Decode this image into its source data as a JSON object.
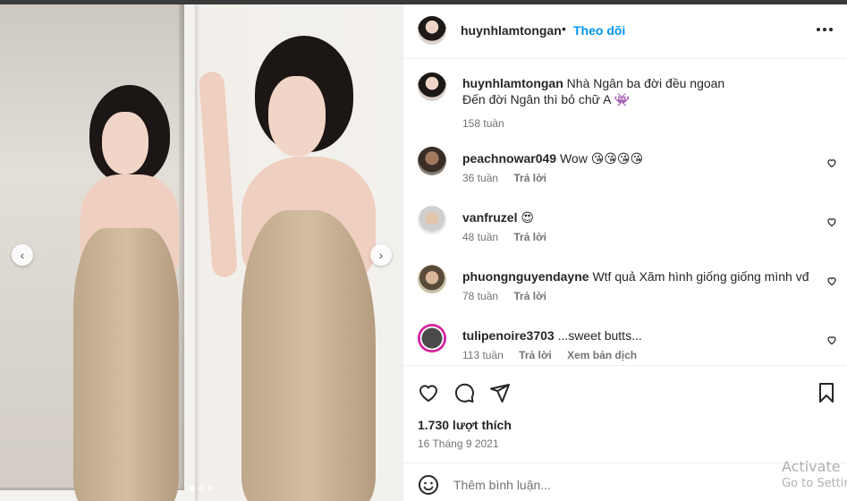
{
  "post": {
    "owner": "huynhlamtongan",
    "separator": "•",
    "follow_label": "Theo dõi",
    "more_icon": "more-horizontal-icon"
  },
  "caption": {
    "user": "huynhlamtongan",
    "line1": "Nhà Ngân ba đời đều ngoan",
    "line2": "Đến đời Ngân thì bỏ chữ A 👾",
    "time": "158 tuần"
  },
  "comments": [
    {
      "user": "peachnowar049",
      "text": "Wow 😘😘😘😘",
      "time": "36 tuần",
      "reply": "Trả lời",
      "extra": ""
    },
    {
      "user": "vanfruzel",
      "text": "😍",
      "time": "48 tuần",
      "reply": "Trả lời",
      "extra": ""
    },
    {
      "user": "phuongnguyendayne",
      "text": "Wtf quả Xăm hình giống giống mình vđ",
      "time": "78 tuần",
      "reply": "Trả lời",
      "extra": ""
    },
    {
      "user": "tulipenoire3703",
      "text": "...sweet butts...",
      "time": "113 tuần",
      "reply": "Trả lời",
      "extra": "Xem bản dịch"
    }
  ],
  "stats": {
    "likes": "1.730 lượt thích",
    "date": "16 Tháng 9 2021"
  },
  "add_comment": {
    "placeholder": "Thêm bình luận..."
  },
  "watermark": {
    "line1": "Activate",
    "line2": "Go to Settings"
  },
  "carousel": {
    "active_index": 0,
    "total": 3
  },
  "colors": {
    "link": "#0095f6",
    "muted": "#737373",
    "text": "#262626"
  }
}
